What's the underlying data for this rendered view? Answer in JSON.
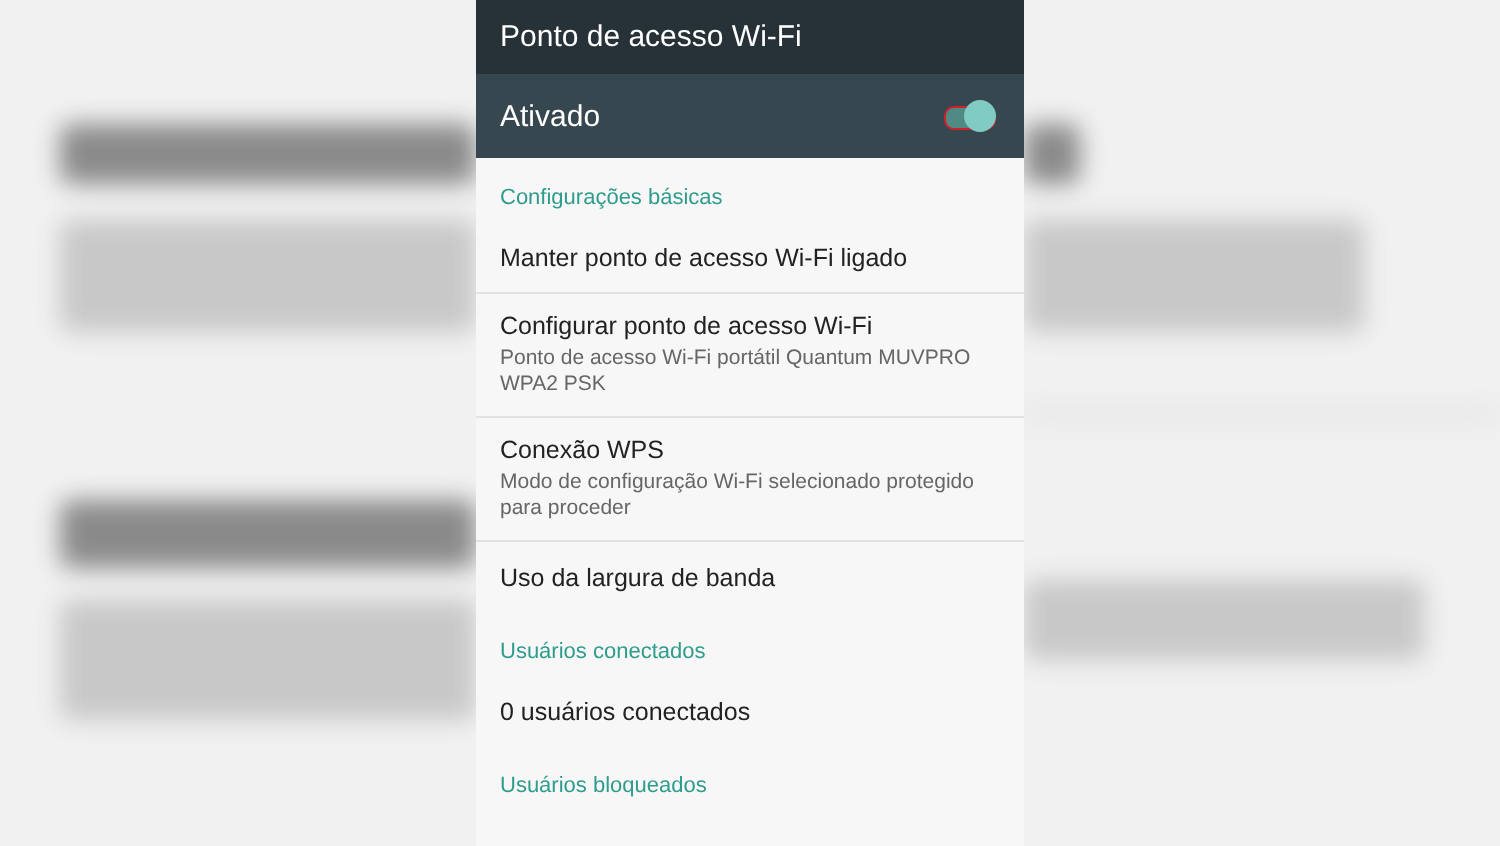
{
  "toolbar": {
    "title": "Ponto de acesso Wi-Fi"
  },
  "master_switch": {
    "label": "Ativado",
    "on": true
  },
  "list": [
    {
      "kind": "header",
      "title": "Configurações básicas"
    },
    {
      "kind": "item",
      "title": "Manter ponto de acesso Wi-Fi ligado"
    },
    {
      "kind": "item",
      "title": "Configurar ponto de acesso Wi-Fi",
      "summary": "Ponto de acesso Wi-Fi portátil Quantum MUVPRO WPA2 PSK"
    },
    {
      "kind": "item",
      "title": "Conexão WPS",
      "summary": "Modo de configuração Wi-Fi selecionado protegido para proceder"
    },
    {
      "kind": "item",
      "title": "Uso da largura de banda"
    },
    {
      "kind": "header",
      "title": "Usuários conectados"
    },
    {
      "kind": "item",
      "title": "0 usuários conectados"
    },
    {
      "kind": "header",
      "title": "Usuários bloqueados"
    }
  ]
}
